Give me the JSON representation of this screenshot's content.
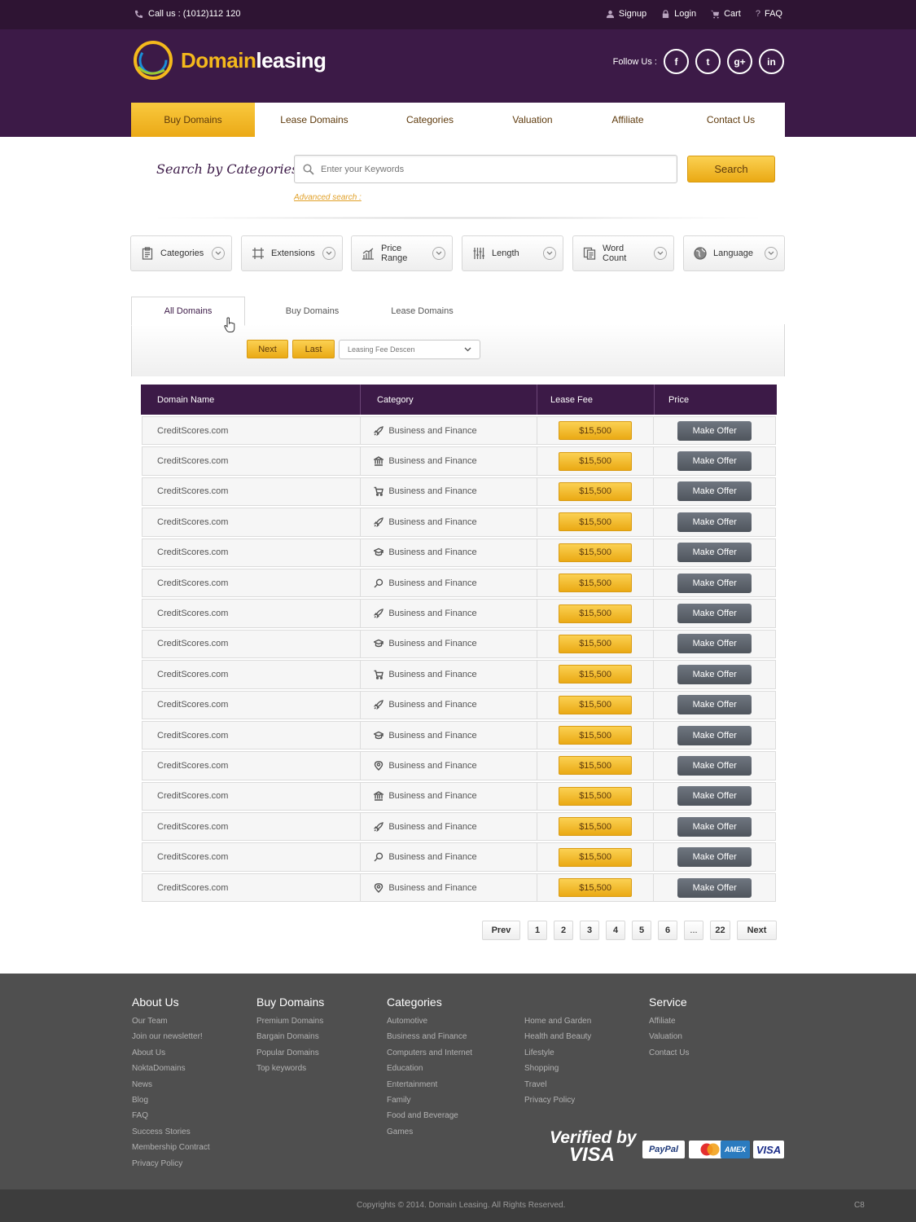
{
  "topbar": {
    "call": "Call us : (1012)112 120",
    "signup": "Signup",
    "login": "Login",
    "cart": "Cart",
    "faq": "FAQ"
  },
  "header": {
    "logo_part1": "Domain",
    "logo_part2": "leasing",
    "follow_label": "Follow Us :",
    "social": [
      "f",
      "t",
      "g+",
      "in"
    ]
  },
  "nav": {
    "items": [
      "Buy Domains",
      "Lease Domains",
      "Categories",
      "Valuation",
      "Affiliate",
      "Contact Us"
    ],
    "active": "Buy Domains"
  },
  "search": {
    "label": "Search by Categories :",
    "placeholder": "Enter your Keywords",
    "button": "Search",
    "advanced": "Advanced search :"
  },
  "filters": [
    "Categories",
    "Extensions",
    "Price Range",
    "Length",
    "Word Count",
    "Language"
  ],
  "tabs": [
    "All Domains",
    "Buy Domains",
    "Lease Domains"
  ],
  "toolbar": {
    "next": "Next",
    "last": "Last",
    "sort": "Leasing Fee Descen"
  },
  "table": {
    "headers": [
      "Domain Name",
      "Category",
      "Lease Fee",
      "Price"
    ],
    "rows": [
      {
        "domain": "CreditScores.com",
        "category": "Business and Finance",
        "icon": "rocket-icon",
        "fee": "$15,500",
        "action": "Make Offer"
      },
      {
        "domain": "CreditScores.com",
        "category": "Business and Finance",
        "icon": "bank-icon",
        "fee": "$15,500",
        "action": "Make Offer"
      },
      {
        "domain": "CreditScores.com",
        "category": "Business and Finance",
        "icon": "cart-icon",
        "fee": "$15,500",
        "action": "Make Offer"
      },
      {
        "domain": "CreditScores.com",
        "category": "Business and Finance",
        "icon": "rocket-icon",
        "fee": "$15,500",
        "action": "Make Offer"
      },
      {
        "domain": "CreditScores.com",
        "category": "Business and Finance",
        "icon": "graduation-cap-icon",
        "fee": "$15,500",
        "action": "Make Offer"
      },
      {
        "domain": "CreditScores.com",
        "category": "Business and Finance",
        "icon": "search-icon",
        "fee": "$15,500",
        "action": "Make Offer"
      },
      {
        "domain": "CreditScores.com",
        "category": "Business and Finance",
        "icon": "rocket-icon",
        "fee": "$15,500",
        "action": "Make Offer"
      },
      {
        "domain": "CreditScores.com",
        "category": "Business and Finance",
        "icon": "graduation-cap-icon",
        "fee": "$15,500",
        "action": "Make Offer"
      },
      {
        "domain": "CreditScores.com",
        "category": "Business and Finance",
        "icon": "cart-icon",
        "fee": "$15,500",
        "action": "Make Offer"
      },
      {
        "domain": "CreditScores.com",
        "category": "Business and Finance",
        "icon": "rocket-icon",
        "fee": "$15,500",
        "action": "Make Offer"
      },
      {
        "domain": "CreditScores.com",
        "category": "Business and Finance",
        "icon": "graduation-cap-icon",
        "fee": "$15,500",
        "action": "Make Offer"
      },
      {
        "domain": "CreditScores.com",
        "category": "Business and Finance",
        "icon": "map-pin-icon",
        "fee": "$15,500",
        "action": "Make Offer"
      },
      {
        "domain": "CreditScores.com",
        "category": "Business and Finance",
        "icon": "bank-icon",
        "fee": "$15,500",
        "action": "Make Offer"
      },
      {
        "domain": "CreditScores.com",
        "category": "Business and Finance",
        "icon": "rocket-icon",
        "fee": "$15,500",
        "action": "Make Offer"
      },
      {
        "domain": "CreditScores.com",
        "category": "Business and Finance",
        "icon": "search-icon",
        "fee": "$15,500",
        "action": "Make Offer"
      },
      {
        "domain": "CreditScores.com",
        "category": "Business and Finance",
        "icon": "map-pin-icon",
        "fee": "$15,500",
        "action": "Make Offer"
      }
    ]
  },
  "pagination": {
    "prev": "Prev",
    "pages": [
      "1",
      "2",
      "3",
      "4",
      "5",
      "6",
      "...",
      "22"
    ],
    "next": "Next"
  },
  "footer": {
    "about": {
      "title": "About Us",
      "links": [
        "Our Team",
        "Join our newsletter!",
        "About Us",
        "NoktaDomains",
        "News",
        "Blog",
        "FAQ",
        "Success Stories",
        "Membership Contract",
        "Privacy Policy"
      ]
    },
    "buy": {
      "title": "Buy Domains",
      "links": [
        "Premium Domains",
        "Bargain Domains",
        "Popular Domains",
        "Top keywords"
      ]
    },
    "categories": {
      "title": "Categories",
      "links": [
        "Automotive",
        "Business and Finance",
        "Computers and Internet",
        "Education",
        "Entertainment",
        "Family",
        "Food and Beverage",
        "Games"
      ]
    },
    "categories2": {
      "links": [
        "Home and Garden",
        "Health and Beauty",
        "Lifestyle",
        "Shopping",
        "Travel",
        "Privacy Policy"
      ]
    },
    "service": {
      "title": "Service",
      "links": [
        "Affiliate",
        "Valuation",
        "Contact Us"
      ]
    },
    "verified_line1": "Verified by",
    "verified_line2": "VISA",
    "cards": [
      "PayPal",
      "MC",
      "AMEX",
      "VISA"
    ],
    "copyright": "Copyrights © 2014. Domain Leasing. All Rights Reserved.",
    "code": "C8"
  },
  "colors": {
    "purple_dark": "#2e1433",
    "purple": "#3c1a47",
    "gold": "#f4b91c",
    "footer": "#4f4f4f"
  }
}
